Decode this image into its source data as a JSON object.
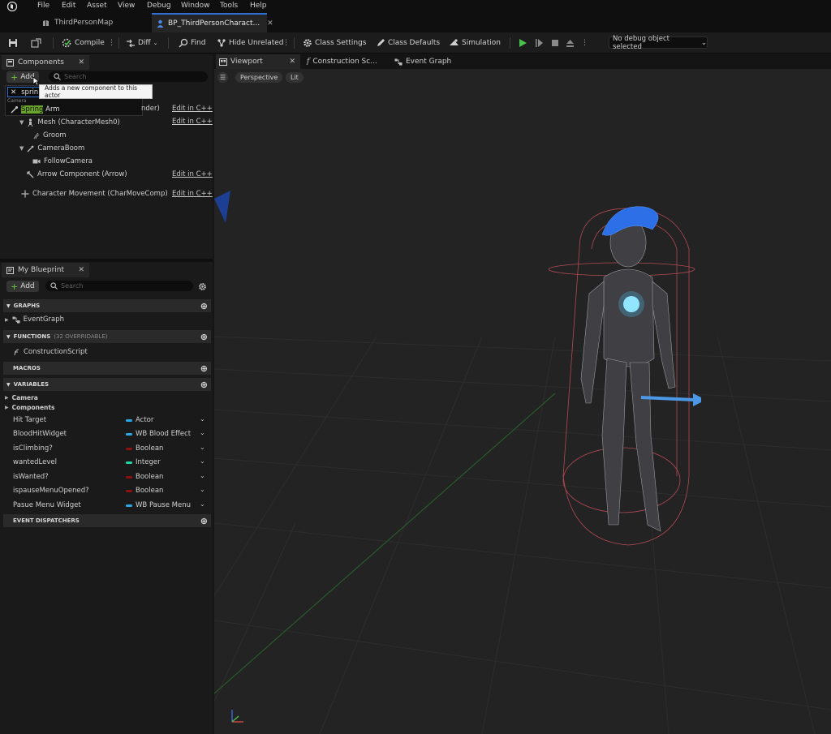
{
  "menu": [
    "File",
    "Edit",
    "Asset",
    "View",
    "Debug",
    "Window",
    "Tools",
    "Help"
  ],
  "tabs": [
    {
      "label": "ThirdPersonMap"
    },
    {
      "label": "BP_ThirdPersonCharact..."
    }
  ],
  "toolbar": {
    "compile": "Compile",
    "diff": "Diff",
    "find": "Find",
    "hide_unrelated": "Hide Unrelated",
    "class_settings": "Class Settings",
    "class_defaults": "Class Defaults",
    "simulation": "Simulation",
    "debug_select": "No debug object selected"
  },
  "components": {
    "tab": "Components",
    "add": "Add",
    "search_placeholder": "Search",
    "filter_text": "sprin",
    "tooltip": "Adds a new component to this actor",
    "suggestion_cat": "Camera",
    "suggestion_highlight": "Spring",
    "suggestion_rest": " Arm",
    "capsule_tail": "nder)",
    "edit_cpp": "Edit in C++",
    "tree": [
      "Mesh (CharacterMesh0)",
      "Groom",
      "CameraBoom",
      "FollowCamera",
      "Arrow Component (Arrow)",
      "Character Movement (CharMoveComp)"
    ]
  },
  "blueprint": {
    "tab": "My Blueprint",
    "add": "Add",
    "search_placeholder": "Search",
    "graphs": "GRAPHS",
    "event_graph": "EventGraph",
    "functions": "FUNCTIONS",
    "functions_count": "(32 OVERRIDABLE)",
    "construction_script": "ConstructionScript",
    "macros": "MACROS",
    "variables": "VARIABLES",
    "cat_camera": "Camera",
    "cat_components": "Components",
    "event_dispatchers": "EVENT DISPATCHERS",
    "vars": [
      {
        "name": "Hit Target",
        "type": "Actor",
        "color": "#2aa7e6"
      },
      {
        "name": "BloodHitWidget",
        "type": "WB Blood Effect",
        "color": "#2aa7e6"
      },
      {
        "name": "isClimbing?",
        "type": "Boolean",
        "color": "#8e1010"
      },
      {
        "name": "wantedLevel",
        "type": "Integer",
        "color": "#1fd6a6"
      },
      {
        "name": "isWanted?",
        "type": "Boolean",
        "color": "#8e1010"
      },
      {
        "name": "ispauseMenuOpened?",
        "type": "Boolean",
        "color": "#8e1010"
      },
      {
        "name": "Pasue Menu Widget",
        "type": "WB Pause Menu",
        "color": "#2aa7e6"
      }
    ]
  },
  "viewport": {
    "tabs": [
      "Viewport",
      "Construction Sc...",
      "Event Graph"
    ],
    "perspective": "Perspective",
    "lit": "Lit"
  },
  "colors": {
    "accent": "#2f6fd6",
    "play": "#4bc24b",
    "highlight": "#6aa52b"
  }
}
